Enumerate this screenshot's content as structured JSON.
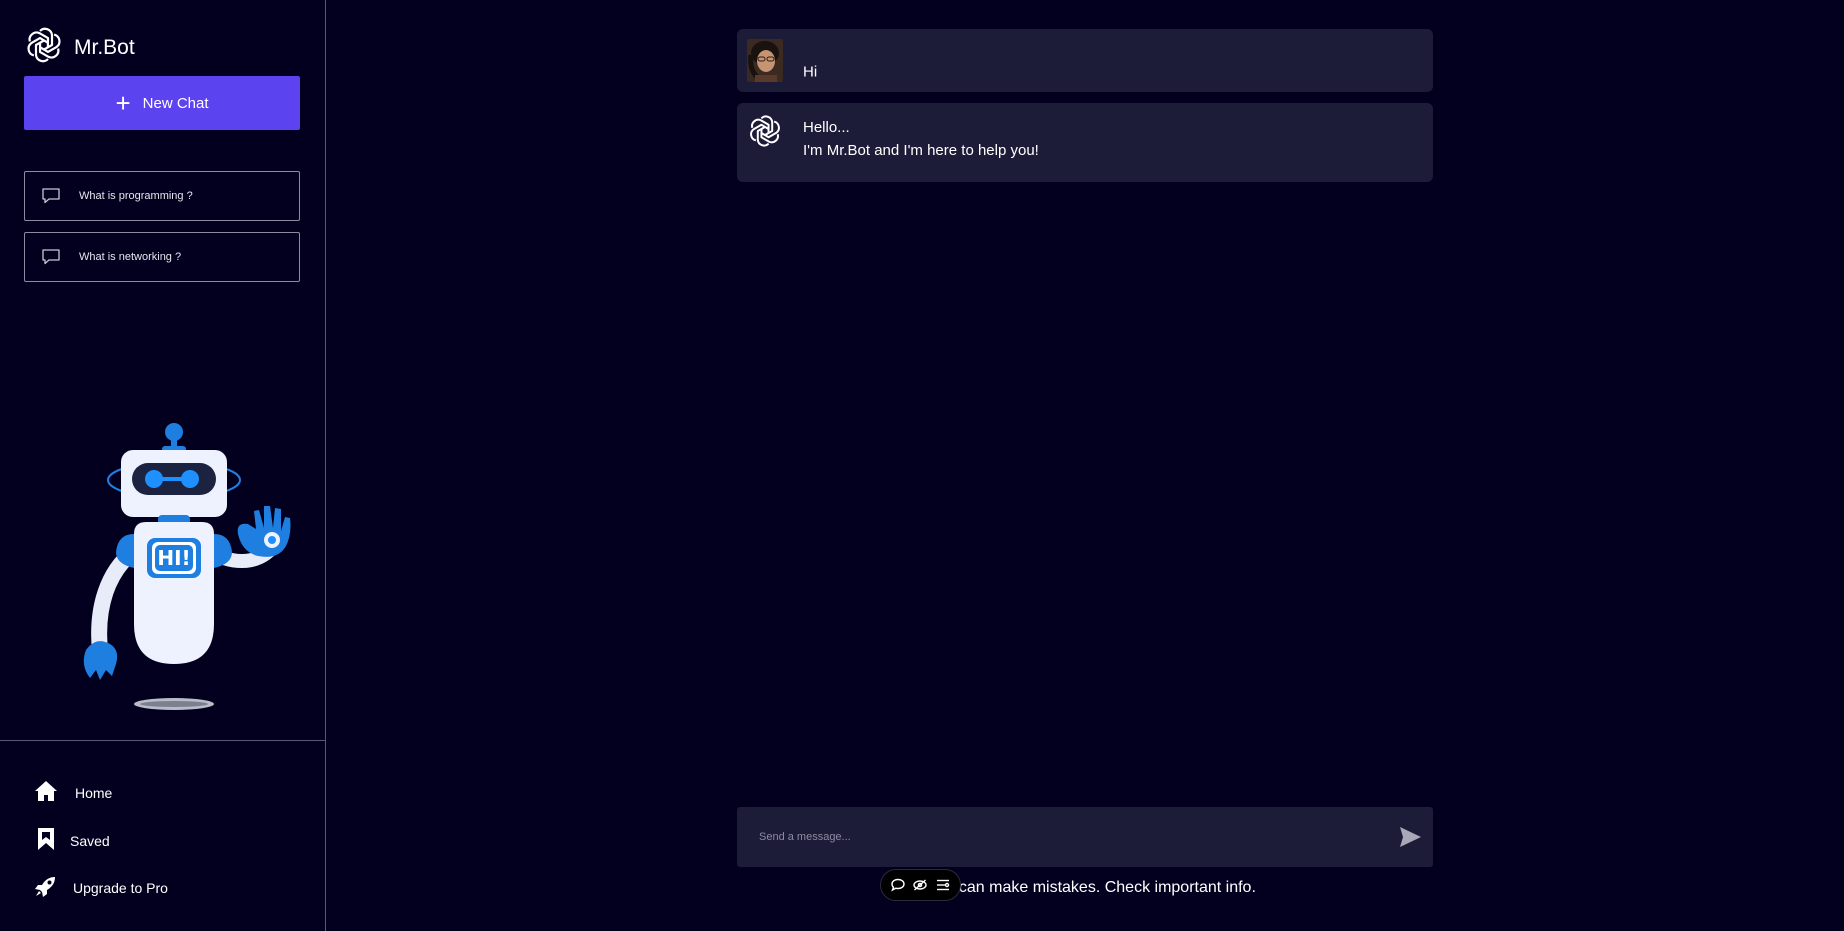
{
  "app": {
    "name": "Mr.Bot"
  },
  "sidebar": {
    "new_chat_label": "New Chat",
    "queries": [
      {
        "label": "What is programming ?"
      },
      {
        "label": "What is networking ?"
      }
    ],
    "footer": [
      {
        "label": "Home",
        "icon": "home-icon"
      },
      {
        "label": "Saved",
        "icon": "bookmark-icon"
      },
      {
        "label": "Upgrade to Pro",
        "icon": "rocket-icon"
      }
    ],
    "illustration_text": "HI!"
  },
  "chat": {
    "messages": [
      {
        "role": "user",
        "lines": [
          "Hi"
        ]
      },
      {
        "role": "bot",
        "lines": [
          "Hello...",
          "I'm Mr.Bot and I'm here to help you!"
        ]
      }
    ]
  },
  "composer": {
    "placeholder": "Send a message..."
  },
  "disclaimer": "t can make mistakes. Check important info.",
  "colors": {
    "background": "#03001f",
    "accent": "#5b43f0",
    "message_bg": "#1d1c38",
    "robot_blue": "#1e7fe0"
  }
}
